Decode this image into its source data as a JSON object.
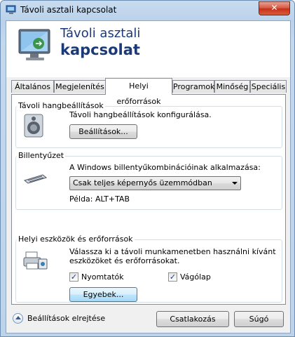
{
  "window": {
    "title": "Távoli asztali kapcsolat",
    "close_label": "✕"
  },
  "banner": {
    "line1": "Távoli asztali",
    "line2": "kapcsolat"
  },
  "tabs": [
    {
      "label": "Általános"
    },
    {
      "label": "Megjelenítés"
    },
    {
      "label": "Helyi erőforrások"
    },
    {
      "label": "Programok"
    },
    {
      "label": "Minőség"
    },
    {
      "label": "Speciális"
    }
  ],
  "active_tab": "Helyi erőforrások",
  "audio": {
    "legend": "Távoli hangbeállítások",
    "description": "Távoli hangbeállítások konfigurálása.",
    "button": "Beállítások..."
  },
  "keyboard": {
    "legend": "Billentyűzet",
    "description": "A Windows billentyűkombinációinak alkalmazása:",
    "selected": "Csak teljes képernyős üzemmódban",
    "example": "Példa: ALT+TAB"
  },
  "local": {
    "legend": "Helyi eszközök és erőforrások",
    "description_line1": "Válassza ki a távoli munkamenetben használni kívánt",
    "description_line2": "eszközöket és erőforrásokat.",
    "printers_label": "Nyomtatók",
    "printers_checked": true,
    "clipboard_label": "Vágólap",
    "clipboard_checked": true,
    "more_button": "Egyebek...",
    "check_mark": "✓"
  },
  "footer": {
    "hide_options": "Beállítások elrejtése",
    "connect": "Csatlakozás",
    "help": "Súgó"
  }
}
